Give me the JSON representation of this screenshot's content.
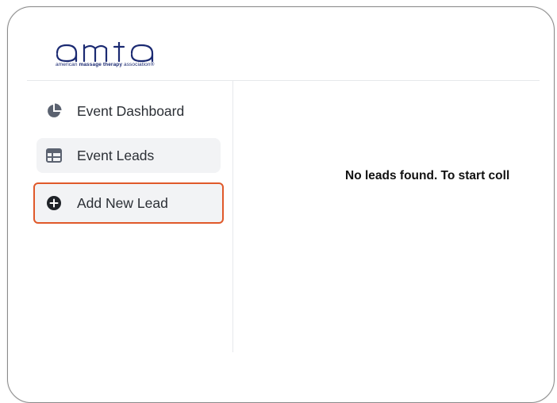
{
  "header": {
    "logo_word": "amta",
    "logo_tagline_prefix": "american",
    "logo_tagline_bold": "massage therapy",
    "logo_tagline_suffix": "association",
    "logo_trademark": "®",
    "logo_color": "#1b2a72"
  },
  "sidebar": {
    "items": [
      {
        "label": "Event Dashboard",
        "icon": "pie-chart-icon",
        "selected": false
      },
      {
        "label": "Event Leads",
        "icon": "table-icon",
        "selected": false
      },
      {
        "label": "Add New Lead",
        "icon": "plus-circle-icon",
        "selected": true
      }
    ],
    "highlight_color": "#e0592a"
  },
  "main": {
    "empty_message": "No leads found. To start coll"
  }
}
